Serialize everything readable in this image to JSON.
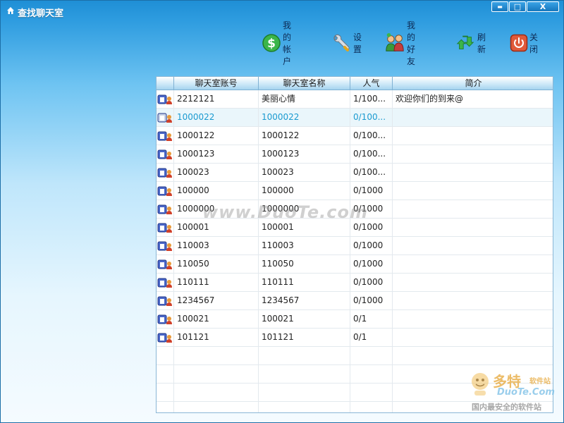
{
  "window": {
    "title": "查找聊天室",
    "controls": {
      "minimize": "▬",
      "maximize": "□",
      "close": "X"
    }
  },
  "toolbar": {
    "items": [
      {
        "label": "我的帐户",
        "icon": "dollar-coin-icon"
      },
      {
        "label": "设置",
        "icon": "wrench-icon"
      },
      {
        "label": "我的好友",
        "icon": "friends-icon"
      },
      {
        "label": "刷新",
        "icon": "refresh-icon"
      },
      {
        "label": "关闭",
        "icon": "power-icon"
      }
    ]
  },
  "grid": {
    "columns": [
      "",
      "聊天室账号",
      "聊天室名称",
      "人气",
      "简介"
    ],
    "rows": [
      {
        "id": "2212121",
        "name": "美丽心情",
        "popularity": "1/100...",
        "intro": "欢迎你们的到来@"
      },
      {
        "id": "1000022",
        "name": "1000022",
        "popularity": "0/100...",
        "intro": "",
        "selected": true
      },
      {
        "id": "1000122",
        "name": "1000122",
        "popularity": "0/100...",
        "intro": ""
      },
      {
        "id": "1000123",
        "name": "1000123",
        "popularity": "0/100...",
        "intro": ""
      },
      {
        "id": "100023",
        "name": "100023",
        "popularity": "0/100...",
        "intro": ""
      },
      {
        "id": "100000",
        "name": "100000",
        "popularity": "0/1000",
        "intro": ""
      },
      {
        "id": "1000000",
        "name": "1000000",
        "popularity": "0/1000",
        "intro": ""
      },
      {
        "id": "100001",
        "name": "100001",
        "popularity": "0/1000",
        "intro": ""
      },
      {
        "id": "110003",
        "name": "110003",
        "popularity": "0/1000",
        "intro": ""
      },
      {
        "id": "110050",
        "name": "110050",
        "popularity": "0/1000",
        "intro": ""
      },
      {
        "id": "110111",
        "name": "110111",
        "popularity": "0/1000",
        "intro": ""
      },
      {
        "id": "1234567",
        "name": "1234567",
        "popularity": "0/1000",
        "intro": ""
      },
      {
        "id": "100021",
        "name": "100021",
        "popularity": "0/1",
        "intro": ""
      },
      {
        "id": "101121",
        "name": "101121",
        "popularity": "0/1",
        "intro": ""
      }
    ]
  },
  "watermarks": {
    "center": "www.DuoTe.com",
    "corner_brand": "多特",
    "corner_small": "软件站",
    "corner_site": "DuoTe.Com",
    "corner_slogan": "国内最安全的软件站"
  },
  "colors": {
    "title_bar": "#1f8fd6",
    "selected_text": "#1a9ad0",
    "grid_border": "#8ab7d6"
  }
}
